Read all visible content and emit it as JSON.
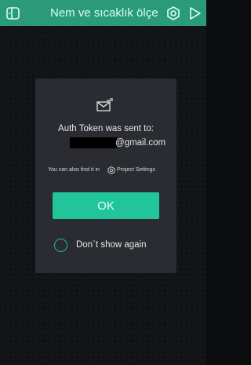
{
  "topbar": {
    "title": "Nem ve sıcaklık ölçe",
    "left_icon": "dashboard-icon",
    "settings_icon": "settings-hex-icon",
    "play_icon": "play-icon",
    "background": "#2b9a78"
  },
  "dialog": {
    "icon": "mail-sent-icon",
    "message_line1": "Auth Token was sent to:",
    "email_suffix": "@gmail.com",
    "hint_prefix": "You can also find it in",
    "hint_link": "Project Settings",
    "hint_icon": "settings-hex-icon",
    "ok_label": "OK",
    "dont_show_label": "Don`t show again",
    "accent": "#22c49a"
  }
}
